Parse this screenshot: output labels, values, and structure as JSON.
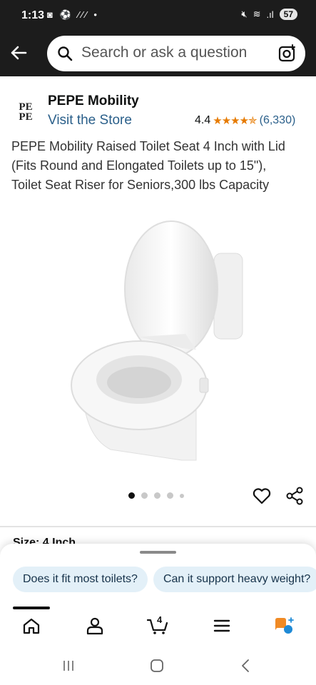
{
  "status_bar": {
    "time": "1:13",
    "battery": "57"
  },
  "search": {
    "placeholder": "Search or ask a question"
  },
  "brand": {
    "logo_line1": "PE",
    "logo_line2": "PE",
    "name": "PEPE Mobility",
    "visit_store": "Visit the Store",
    "rating": "4.4",
    "stars": "★★★★✯",
    "rating_count": "(6,330)"
  },
  "product": {
    "title": "PEPE Mobility Raised Toilet Seat 4 Inch with Lid (Fits Round and Elongated Toilets up to 15\"), Toilet Seat Riser for Seniors,300 lbs Capacity",
    "image_count": 5,
    "active_image_index": 0
  },
  "size_label_partial": "Size: 4 Inch",
  "chips": [
    "Does it fit most toilets?",
    "Can it support heavy weight?"
  ],
  "bottom_nav": {
    "items": [
      "home-icon",
      "account-icon",
      "cart-icon",
      "menu-icon",
      "rufus-icon"
    ],
    "cart_count": "4"
  },
  "colors": {
    "header_bg": "#1c1c1c",
    "link": "#2a5f8a",
    "stars": "#e67a00",
    "chip_bg": "#e3f0f8"
  }
}
